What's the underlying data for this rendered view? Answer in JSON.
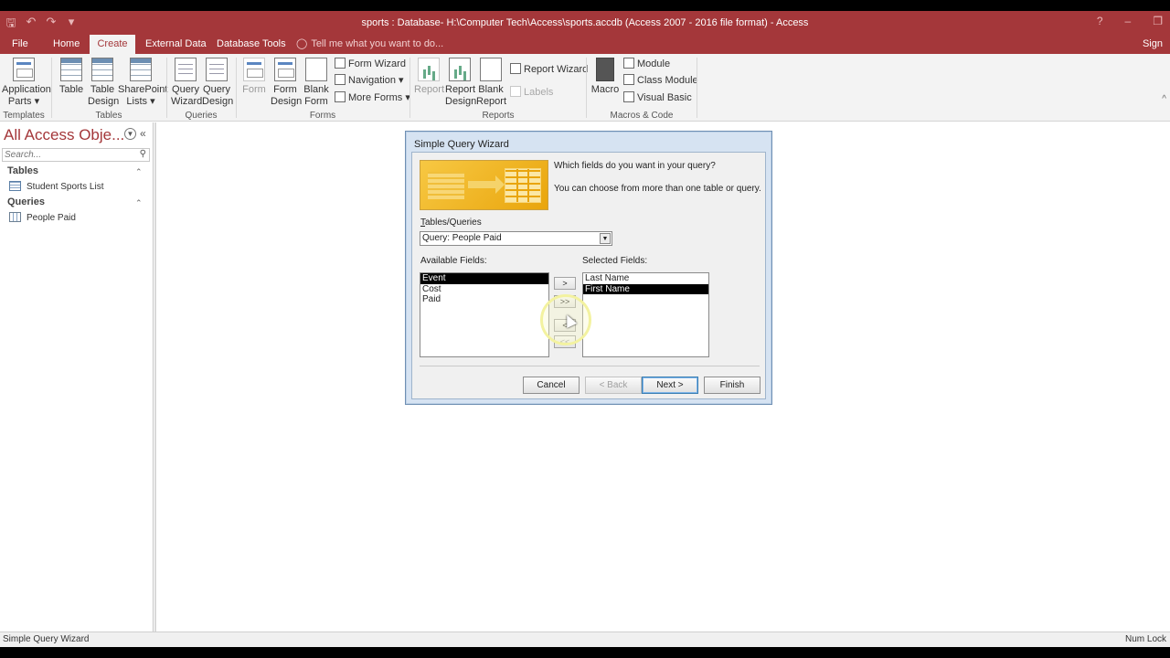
{
  "window": {
    "title": "sports : Database- H:\\Computer Tech\\Access\\sports.accdb (Access 2007 - 2016 file format) - Access",
    "help": "?"
  },
  "ribbon_tabs": [
    "File",
    "Home",
    "Create",
    "External Data",
    "Database Tools"
  ],
  "tell_me": "Tell me what you want to do...",
  "sign_in": "Sign",
  "ribbon": {
    "templates": {
      "app_parts_1": "Application",
      "app_parts_2": "Parts",
      "group": "Templates"
    },
    "tables": {
      "table": "Table",
      "table_design_1": "Table",
      "table_design_2": "Design",
      "sharepoint_1": "SharePoint",
      "sharepoint_2": "Lists",
      "group": "Tables"
    },
    "queries": {
      "wizard_1": "Query",
      "wizard_2": "Wizard",
      "design_1": "Query",
      "design_2": "Design",
      "group": "Queries"
    },
    "forms": {
      "form": "Form",
      "form_design_1": "Form",
      "form_design_2": "Design",
      "blank_1": "Blank",
      "blank_2": "Form",
      "form_wizard": "Form Wizard",
      "navigation": "Navigation",
      "more_forms": "More Forms",
      "group": "Forms"
    },
    "reports": {
      "report": "Report",
      "report_design_1": "Report",
      "report_design_2": "Design",
      "blank_1": "Blank",
      "blank_2": "Report",
      "report_wizard": "Report Wizard",
      "labels": "Labels",
      "group": "Reports"
    },
    "macros": {
      "macro": "Macro",
      "module": "Module",
      "class_module": "Class Module",
      "visual_basic": "Visual Basic",
      "group": "Macros & Code"
    }
  },
  "nav_pane": {
    "title": "All Access Obje...",
    "search_placeholder": "Search...",
    "groups": [
      {
        "name": "Tables",
        "items": [
          "Student Sports List"
        ]
      },
      {
        "name": "Queries",
        "items": [
          "People Paid"
        ]
      }
    ]
  },
  "dialog": {
    "title": "Simple Query Wizard",
    "instruction_1": "Which fields do you want in your query?",
    "instruction_2": "You can choose from more than one table or query.",
    "tables_queries_label": "Tables/Queries",
    "tables_queries_value": "Query: People Paid",
    "available_label": "Available Fields:",
    "available_fields": [
      "Event",
      "Cost",
      "Paid"
    ],
    "selected_label": "Selected Fields:",
    "selected_fields": [
      "Last Name",
      "First Name"
    ],
    "move_buttons": [
      ">",
      ">>",
      "<",
      "<<"
    ],
    "buttons": {
      "cancel": "Cancel",
      "back": "< Back",
      "next": "Next >",
      "finish": "Finish"
    }
  },
  "status": {
    "left": "Simple Query Wizard",
    "right": "Num Lock"
  },
  "colors": {
    "accent": "#a4373a",
    "dialog_frame": "#d6e3f2"
  }
}
